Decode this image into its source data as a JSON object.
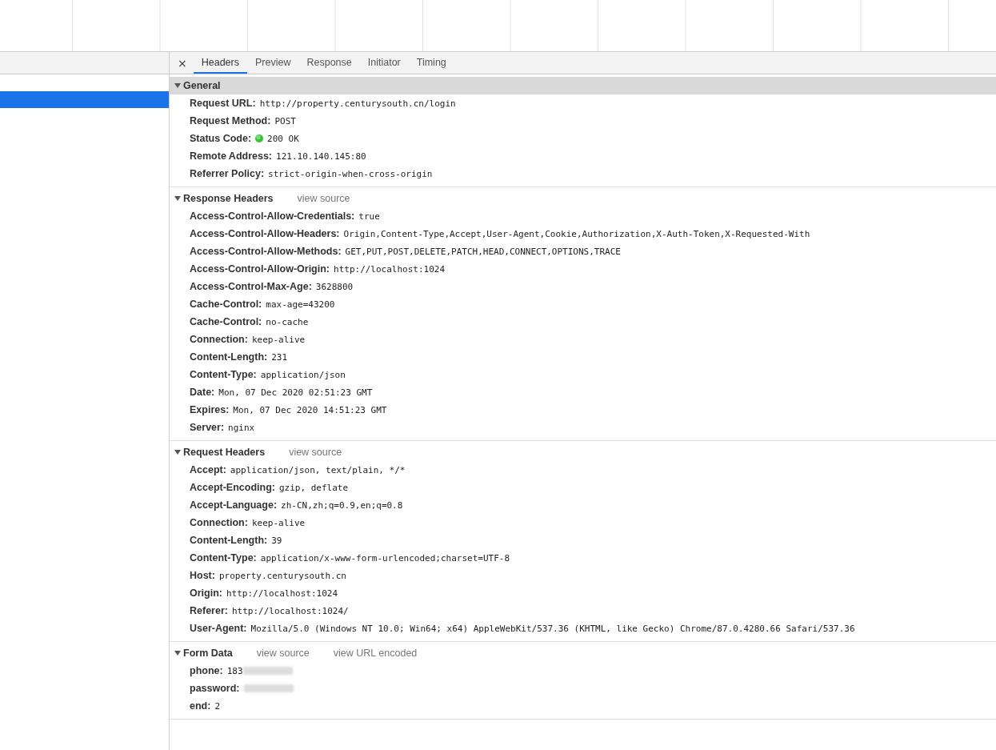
{
  "request_list": {
    "rows": [
      {
        "selected": true
      }
    ]
  },
  "close_label": "×",
  "tabs": [
    {
      "label": "Headers",
      "selected": true
    },
    {
      "label": "Preview",
      "selected": false
    },
    {
      "label": "Response",
      "selected": false
    },
    {
      "label": "Initiator",
      "selected": false
    },
    {
      "label": "Timing",
      "selected": false
    }
  ],
  "sections": [
    {
      "title": "General",
      "expanded": true,
      "highlighted": true,
      "rows": [
        {
          "name": "Request URL:",
          "value": "http://property.centurysouth.cn/login"
        },
        {
          "name": "Request Method:",
          "value": "POST"
        },
        {
          "name": "Status Code:",
          "value": "200 OK",
          "kind": "status",
          "color": "#2ec52e"
        },
        {
          "name": "Remote Address:",
          "value": "121.10.140.145:80"
        },
        {
          "name": "Referrer Policy:",
          "value": "strict-origin-when-cross-origin"
        }
      ]
    },
    {
      "title": "Response Headers",
      "expanded": true,
      "highlighted": false,
      "links": [
        "view source"
      ],
      "rows": [
        {
          "name": "Access-Control-Allow-Credentials:",
          "value": "true"
        },
        {
          "name": "Access-Control-Allow-Headers:",
          "value": "Origin,Content-Type,Accept,User-Agent,Cookie,Authorization,X-Auth-Token,X-Requested-With"
        },
        {
          "name": "Access-Control-Allow-Methods:",
          "value": "GET,PUT,POST,DELETE,PATCH,HEAD,CONNECT,OPTIONS,TRACE"
        },
        {
          "name": "Access-Control-Allow-Origin:",
          "value": "http://localhost:1024"
        },
        {
          "name": "Access-Control-Max-Age:",
          "value": "3628800"
        },
        {
          "name": "Cache-Control:",
          "value": "max-age=43200"
        },
        {
          "name": "Cache-Control:",
          "value": "no-cache"
        },
        {
          "name": "Connection:",
          "value": "keep-alive"
        },
        {
          "name": "Content-Length:",
          "value": "231"
        },
        {
          "name": "Content-Type:",
          "value": "application/json"
        },
        {
          "name": "Date:",
          "value": "Mon, 07 Dec 2020 02:51:23 GMT"
        },
        {
          "name": "Expires:",
          "value": "Mon, 07 Dec 2020 14:51:23 GMT"
        },
        {
          "name": "Server:",
          "value": "nginx"
        }
      ]
    },
    {
      "title": "Request Headers",
      "expanded": true,
      "highlighted": false,
      "links": [
        "view source"
      ],
      "rows": [
        {
          "name": "Accept:",
          "value": "application/json, text/plain, */*"
        },
        {
          "name": "Accept-Encoding:",
          "value": "gzip, deflate"
        },
        {
          "name": "Accept-Language:",
          "value": "zh-CN,zh;q=0.9,en;q=0.8"
        },
        {
          "name": "Connection:",
          "value": "keep-alive"
        },
        {
          "name": "Content-Length:",
          "value": "39"
        },
        {
          "name": "Content-Type:",
          "value": "application/x-www-form-urlencoded;charset=UTF-8"
        },
        {
          "name": "Host:",
          "value": "property.centurysouth.cn"
        },
        {
          "name": "Origin:",
          "value": "http://localhost:1024"
        },
        {
          "name": "Referer:",
          "value": "http://localhost:1024/"
        },
        {
          "name": "User-Agent:",
          "value": "Mozilla/5.0 (Windows NT 10.0; Win64; x64) AppleWebKit/537.36 (KHTML, like Gecko) Chrome/87.0.4280.66 Safari/537.36"
        }
      ]
    },
    {
      "title": "Form Data",
      "expanded": true,
      "highlighted": false,
      "links": [
        "view source",
        "view URL encoded"
      ],
      "rows": [
        {
          "name": "phone:",
          "value": "183",
          "redacted": true
        },
        {
          "name": "password:",
          "redacted": true
        },
        {
          "name": "end:",
          "value": "2"
        }
      ]
    }
  ]
}
